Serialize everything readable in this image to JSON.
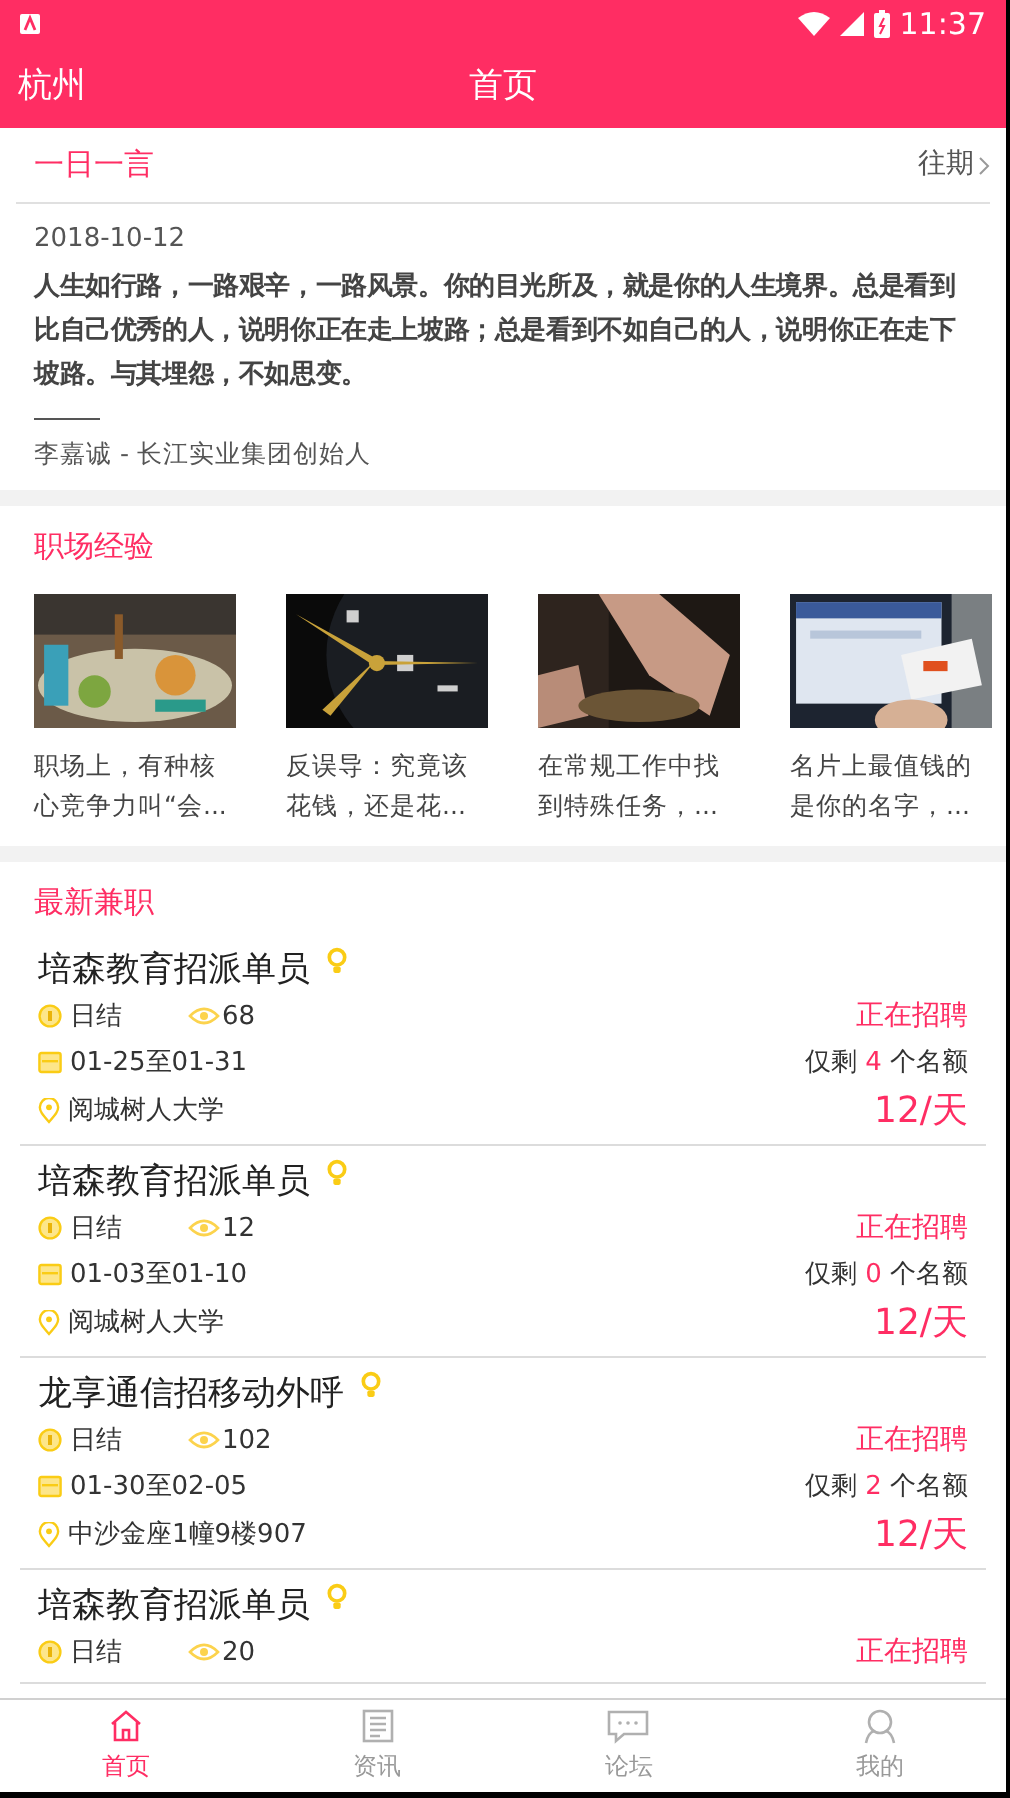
{
  "status_bar": {
    "time": "11:37"
  },
  "header": {
    "city": "杭州",
    "title": "首页"
  },
  "quote": {
    "title": "一日一言",
    "more": "往期",
    "date": "2018-10-12",
    "text": "人生如行路，一路艰辛，一路风景。你的目光所及，就是你的人生境界。总是看到比自己优秀的人，说明你正在走上坡路；总是看到不如自己的人，说明你正在走下坡路。与其埋怨，不如思变。",
    "author": "李嘉诚 - 长江实业集团创始人"
  },
  "experience": {
    "title": "职场经验",
    "articles": [
      {
        "kind": "picture",
        "title": "职场上，有种核心竞争力叫“会..."
      },
      {
        "kind": "picture",
        "title": "反误导：究竟该花钱，还是花..."
      },
      {
        "kind": "picture",
        "title": "在常规工作中找到特殊任务，..."
      },
      {
        "kind": "picture",
        "title": "名片上最值钱的是你的名字，..."
      }
    ]
  },
  "jobs": {
    "title": "最新兼职",
    "items": [
      {
        "title": "培森教育招派单员",
        "pay_type": "日结",
        "views": "68",
        "status": "正在招聘",
        "dates": "01-25至01-31",
        "remaining_prefix": "仅剩",
        "remaining": "4",
        "remaining_suffix": "个名额",
        "location": "阅城树人大学",
        "wage": "12/天"
      },
      {
        "title": "培森教育招派单员",
        "pay_type": "日结",
        "views": "12",
        "status": "正在招聘",
        "dates": "01-03至01-10",
        "remaining_prefix": "仅剩",
        "remaining": "0",
        "remaining_suffix": "个名额",
        "location": "阅城树人大学",
        "wage": "12/天"
      },
      {
        "title": "龙享通信招移动外呼",
        "pay_type": "日结",
        "views": "102",
        "status": "正在招聘",
        "dates": "01-30至02-05",
        "remaining_prefix": "仅剩",
        "remaining": "2",
        "remaining_suffix": "个名额",
        "location": "中沙金座1幢9楼907",
        "wage": "12/天"
      },
      {
        "title": "培森教育招派单员",
        "pay_type": "日结",
        "views": "20",
        "status": "正在招聘"
      }
    ]
  },
  "tabs": [
    {
      "label": "首页",
      "kind": "home",
      "selected": true
    },
    {
      "label": "资讯",
      "kind": "news",
      "selected": false
    },
    {
      "label": "论坛",
      "kind": "forum",
      "selected": false
    },
    {
      "label": "我的",
      "kind": "profile",
      "selected": false
    }
  ]
}
